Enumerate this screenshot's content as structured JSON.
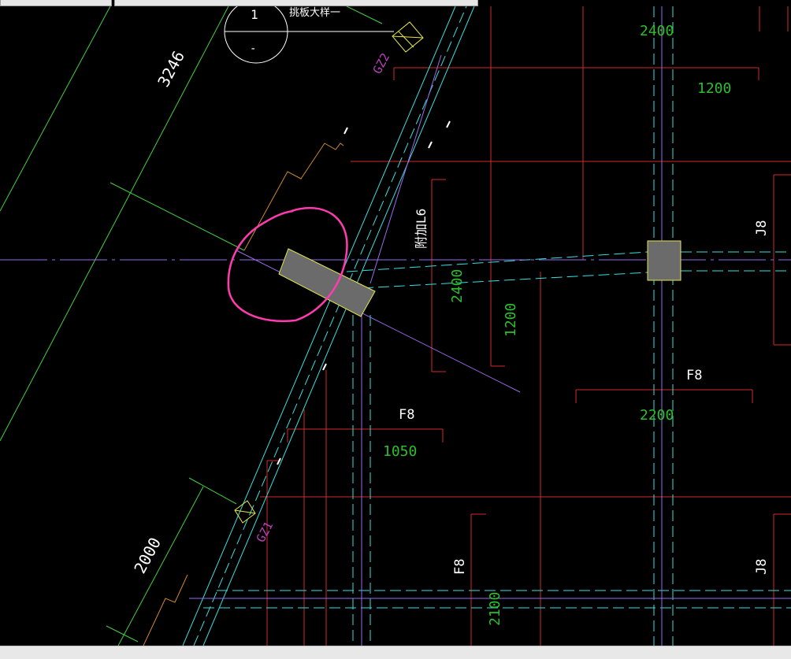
{
  "drawing": {
    "labels": {
      "dim_3246": "3246",
      "dim_2000": "2000",
      "dim_2400_top": "2400",
      "dim_1200_top": "1200",
      "dim_2400_mid": "2400",
      "dim_1200_mid": "1200",
      "dim_1050": "1050",
      "dim_2200": "2200",
      "dim_2100": "2100",
      "beam_f8_a": "F8",
      "beam_f8_b": "F8",
      "beam_f8_c": "F8",
      "beam_j8_a": "J8",
      "beam_j8_b": "J8",
      "gz2": "GZ2",
      "gz1": "GZ1",
      "beam_l6": "附加L6",
      "detail_num": "1",
      "detail_dash": "-",
      "detail_title": "挑板大样一"
    },
    "colors": {
      "background": "#000000",
      "axis_cyan": "#37e0e0",
      "beam_red": "#d42a2a",
      "dim_green": "#2bbf2b",
      "line_green": "#40d040",
      "purple_axis": "#9a6bf0",
      "orange": "#d08a2a",
      "highlight_magenta": "#ff3bb0",
      "column_fill": "#6b6b6b",
      "column_stroke": "#e6e64a",
      "label_magenta": "#c040c0",
      "text_white": "#ffffff"
    }
  }
}
